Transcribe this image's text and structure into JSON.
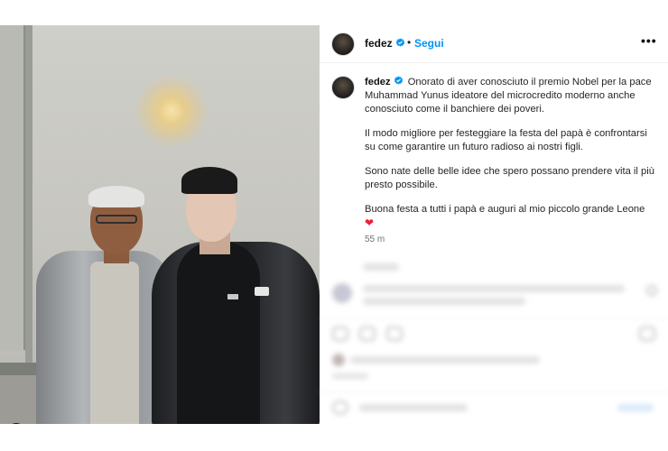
{
  "post": {
    "username": "fedez",
    "separator": "•",
    "follow_label": "Segui",
    "more_label": "•••",
    "caption_paragraphs": [
      "Onorato di aver conosciuto il premio Nobel per la pace Muhammad Yunus ideatore del microcredito moderno anche conosciuto come il banchiere dei poveri.",
      "Il modo migliore per festeggiare la festa del papà è confrontarsi su come garantire un futuro radioso ai nostri figli.",
      "Sono nate delle belle idee che spero possano prendere vita il più presto possibile.",
      "Buona festa a tutti i papà e auguri al mio piccolo grande Leone"
    ],
    "heart_emoji": "❤",
    "timestamp": "55 m"
  },
  "icons": {
    "verified": "verified-badge-icon",
    "more": "more-options-icon",
    "tagged_user": "tagged-user-icon",
    "heart": "heart-emoji-icon"
  },
  "colors": {
    "accent": "#0095f6",
    "heart": "#ed1f3b",
    "muted": "#737373"
  }
}
